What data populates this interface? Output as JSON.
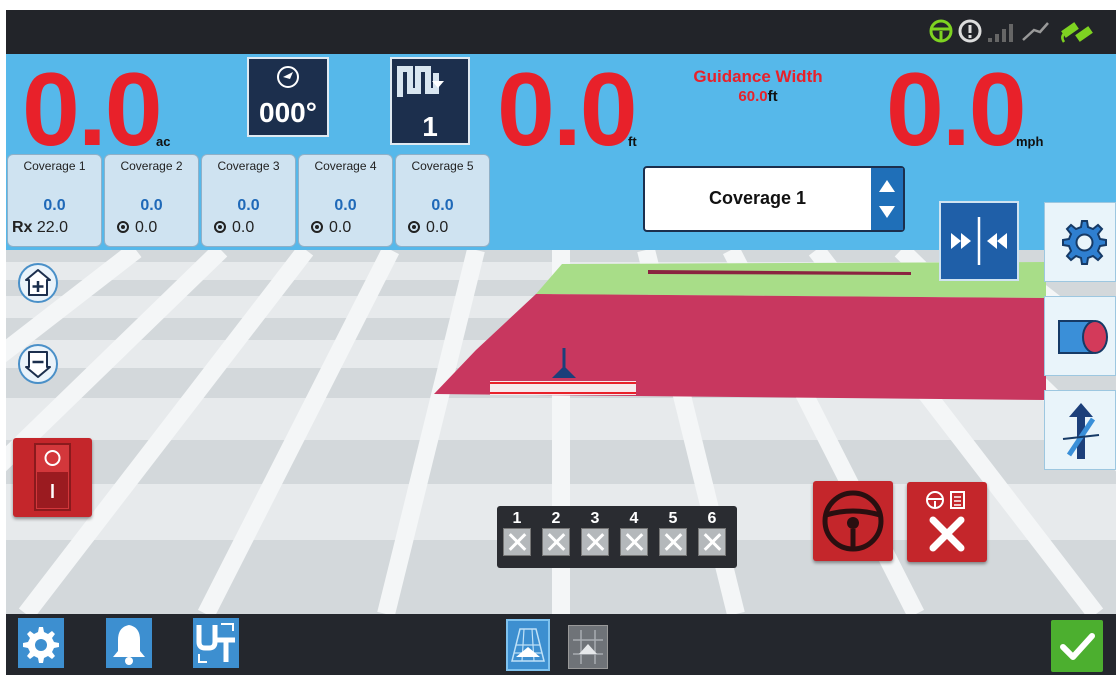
{
  "area": {
    "value": "0.0",
    "unit": "ac"
  },
  "heading": {
    "value": "000°"
  },
  "guidance_pattern": {
    "value": "1"
  },
  "cross_track": {
    "value": "0.0",
    "unit": "ft"
  },
  "guidance_width": {
    "label": "Guidance Width",
    "value": "60.0",
    "unit": "ft"
  },
  "speed": {
    "value": "0.0",
    "unit": "mph"
  },
  "coverages": [
    {
      "label": "Coverage 1",
      "value": "0.0",
      "bottom_value": "22.0",
      "bottom_icon": "rx-icon"
    },
    {
      "label": "Coverage 2",
      "value": "0.0",
      "bottom_value": "0.0",
      "bottom_icon": "target-icon"
    },
    {
      "label": "Coverage 3",
      "value": "0.0",
      "bottom_value": "0.0",
      "bottom_icon": "target-icon"
    },
    {
      "label": "Coverage 4",
      "value": "0.0",
      "bottom_value": "0.0",
      "bottom_icon": "target-icon"
    },
    {
      "label": "Coverage 5",
      "value": "0.0",
      "bottom_value": "0.0",
      "bottom_icon": "target-icon"
    }
  ],
  "coverage_select": {
    "selected": "Coverage 1"
  },
  "rx_symbol": "Rx",
  "sections": [
    "1",
    "2",
    "3",
    "4",
    "5",
    "6"
  ],
  "colors": {
    "accent": "#56b8ea",
    "big_number": "#e8212a",
    "coverage_fill": "#c8375f",
    "coverage_green": "#a8dd88",
    "ok_green": "#4caf2f"
  }
}
